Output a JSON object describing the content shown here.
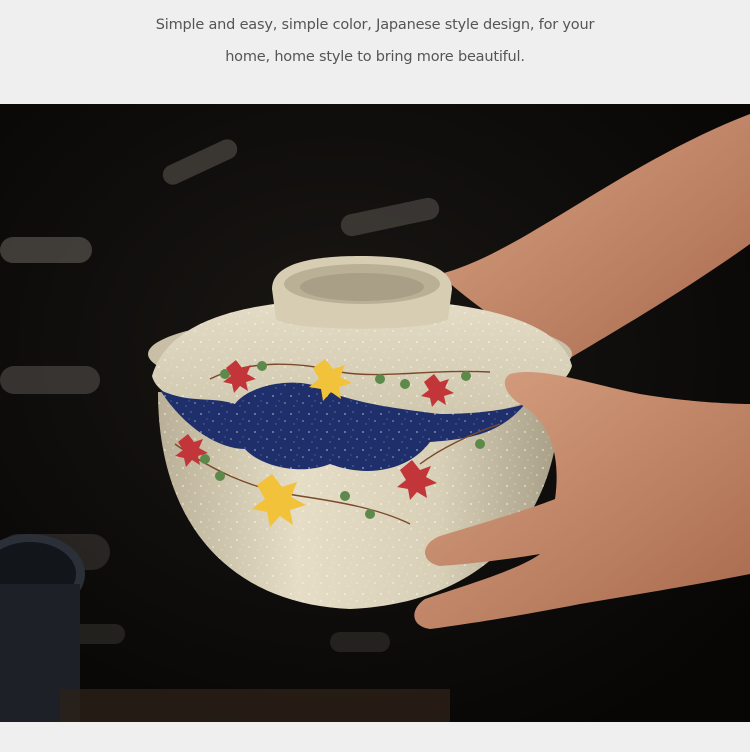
{
  "caption": {
    "line1": "Simple and easy, simple color, Japanese style design, for your",
    "line2": "home, home style to bring more beautiful."
  },
  "photo": {
    "subject": "product-photo",
    "colors": {
      "background": "#0b0a09",
      "bowl_glaze": "#d9d0b8",
      "navy_band": "#1f2f6b",
      "maple_yellow": "#f2c23a",
      "maple_red": "#c2363a",
      "skin": "#c78e6c"
    }
  }
}
